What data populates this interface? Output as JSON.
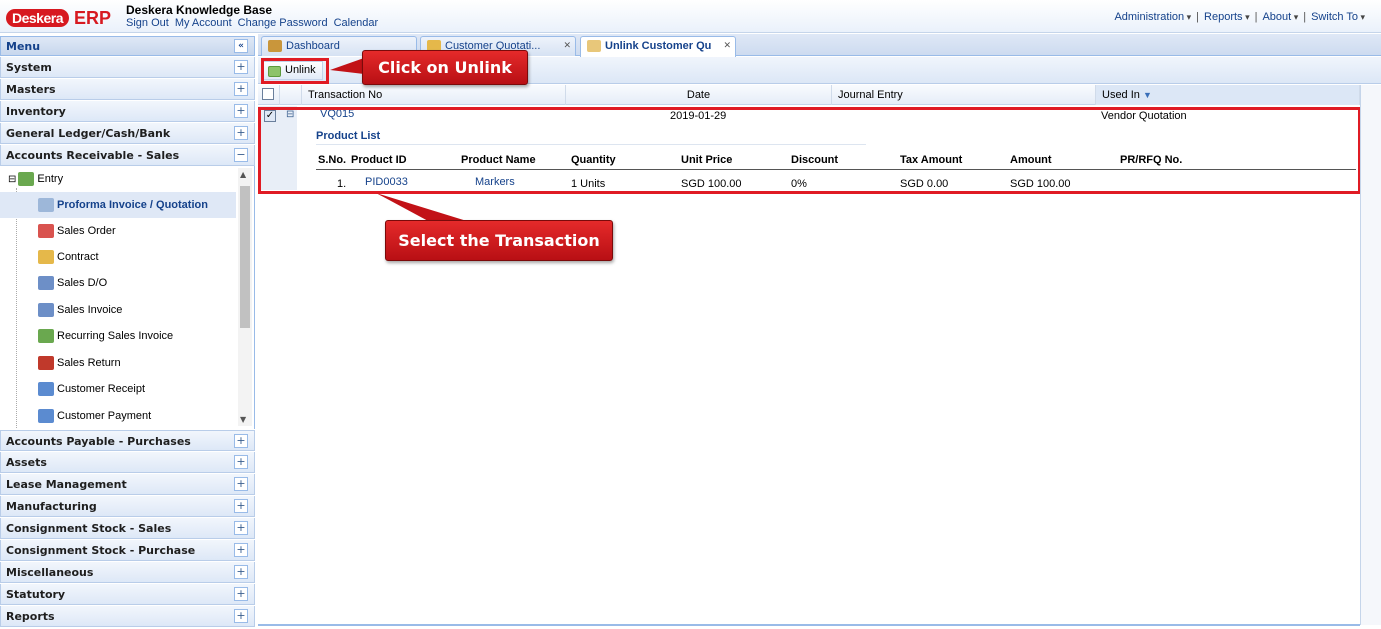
{
  "header": {
    "logo_left": "Deskera",
    "logo_right": "ERP",
    "kb_title": "Deskera Knowledge Base",
    "links": [
      "Sign Out",
      "My Account",
      "Change Password",
      "Calendar"
    ],
    "right_menu": [
      "Administration",
      "Reports",
      "About",
      "Switch To"
    ]
  },
  "sidebar": {
    "menu_title": "Menu",
    "sections_top": [
      "System",
      "Masters",
      "Inventory",
      "General Ledger/Cash/Bank",
      "Accounts Receivable - Sales"
    ],
    "tree_root": "Entry",
    "tree_items": [
      {
        "label": "Proforma Invoice / Quotation",
        "icon": "quotation-icon",
        "color": "#9db7d9"
      },
      {
        "label": "Sales Order",
        "icon": "sales-order-icon",
        "color": "#d9534f"
      },
      {
        "label": "Contract",
        "icon": "contract-icon",
        "color": "#e5b84a"
      },
      {
        "label": "Sales D/O",
        "icon": "delivery-order-icon",
        "color": "#6d8fc7"
      },
      {
        "label": "Sales Invoice",
        "icon": "sales-invoice-icon",
        "color": "#6d8fc7"
      },
      {
        "label": "Recurring Sales Invoice",
        "icon": "recurring-invoice-icon",
        "color": "#6aa84f"
      },
      {
        "label": "Sales Return",
        "icon": "sales-return-icon",
        "color": "#c0392b"
      },
      {
        "label": "Customer Receipt",
        "icon": "customer-receipt-icon",
        "color": "#5b8bd0"
      },
      {
        "label": "Customer Payment",
        "icon": "customer-payment-icon",
        "color": "#5b8bd0"
      }
    ],
    "sections_bottom": [
      "Accounts Payable - Purchases",
      "Assets",
      "Lease Management",
      "Manufacturing",
      "Consignment Stock - Sales",
      "Consignment Stock - Purchase",
      "Miscellaneous",
      "Statutory",
      "Reports"
    ]
  },
  "tabs": [
    {
      "label": "Dashboard",
      "active": false
    },
    {
      "label": "Customer Quotati...",
      "active": false
    },
    {
      "label": "Unlink Customer Qu",
      "active": true
    }
  ],
  "toolbar": {
    "unlink_label": "Unlink"
  },
  "grid": {
    "columns": [
      "Transaction No",
      "Date",
      "Journal Entry",
      "Used In"
    ],
    "row": {
      "transaction_no": "VQ015",
      "date": "2019-01-29",
      "journal_entry": "",
      "used_in": "Vendor Quotation",
      "checked": true
    },
    "product_list_title": "Product List",
    "product_columns": [
      "S.No.",
      "Product ID",
      "Product Name",
      "Quantity",
      "Unit Price",
      "Discount",
      "Tax Amount",
      "Amount",
      "PR/RFQ No."
    ],
    "product_row": [
      "1.",
      "PID0033",
      "Markers",
      "1 Units",
      "SGD 100.00",
      "0%",
      "SGD 0.00",
      "SGD 100.00",
      ""
    ]
  },
  "callouts": {
    "unlink": "Click on Unlink",
    "transaction": "Select the Transaction"
  },
  "colors": {
    "accent": "#15428b",
    "highlight": "#e01b24",
    "brand": "#d71920"
  }
}
